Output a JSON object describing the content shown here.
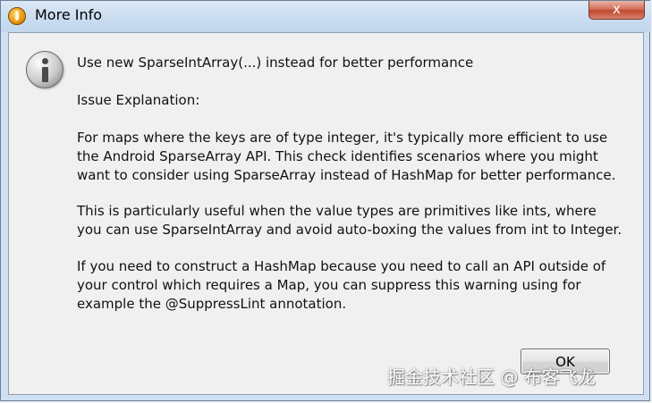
{
  "window": {
    "title": "More Info",
    "close_label": "x"
  },
  "dialog": {
    "icon": "info-icon",
    "summary": "Use new SparseIntArray(...) instead for better performance",
    "heading": "Issue Explanation:",
    "paragraphs": [
      "For maps where the keys are of type integer, it's typically more efficient to use the Android SparseArray API. This check identifies scenarios where you might want to consider using SparseArray instead of HashMap for better performance.",
      "This is particularly useful when the value types are primitives like ints, where you can use SparseIntArray and avoid auto-boxing the values from int to Integer.",
      "If you need to construct a HashMap because you need to call an API outside of your control which requires a Map, you can suppress this warning using for example the @SuppressLint annotation."
    ],
    "ok_label": "OK"
  },
  "watermark": "掘金技术社区 @ 布客飞龙",
  "colors": {
    "titlebar": "#c9dcf0",
    "client_bg": "#f0f0f0",
    "close_button": "#c14a31"
  }
}
